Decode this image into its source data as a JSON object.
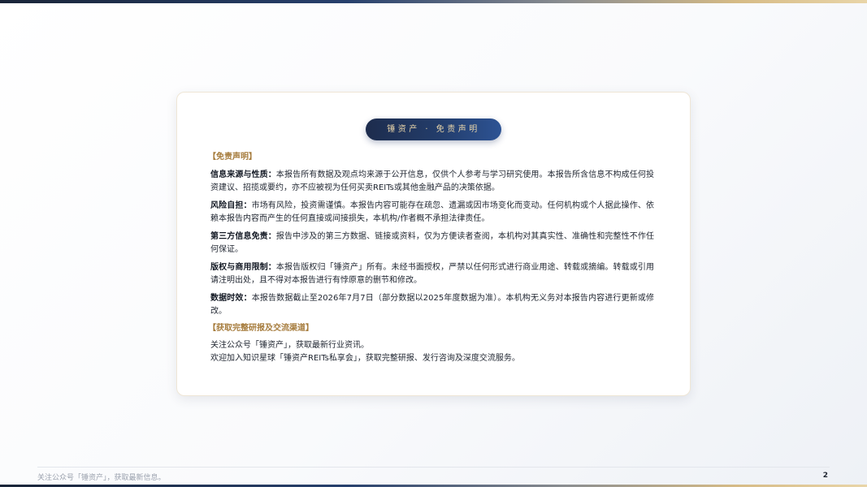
{
  "header": {
    "badge": "锤资产 · 免责声明"
  },
  "disclaimer": {
    "title": "【免责声明】",
    "items": [
      {
        "label": "信息来源与性质：",
        "text": "本报告所有数据及观点均来源于公开信息，仅供个人参考与学习研究使用。本报告所含信息不构成任何投资建议、招揽或要约，亦不应被视为任何买卖REITs或其他金融产品的决策依据。"
      },
      {
        "label": "风险自担：",
        "text": "市场有风险，投资需谨慎。本报告内容可能存在疏忽、遗漏或因市场变化而变动。任何机构或个人据此操作、依赖本报告内容而产生的任何直接或间接损失，本机构/作者概不承担法律责任。"
      },
      {
        "label": "第三方信息免责：",
        "text": "报告中涉及的第三方数据、链接或资料，仅为方便读者查阅，本机构对其真实性、准确性和完整性不作任何保证。"
      },
      {
        "label": "版权与商用限制：",
        "text": "本报告版权归「锤资产」所有。未经书面授权，严禁以任何形式进行商业用途、转载或摘编。转载或引用请注明出处，且不得对本报告进行有悖原意的删节和修改。"
      },
      {
        "label": "数据时效：",
        "text": "本报告数据截止至2026年7月7日（部分数据以2025年度数据为准）。本机构无义务对本报告内容进行更新或修改。"
      }
    ]
  },
  "channels": {
    "title": "【获取完整研报及交流渠道】",
    "lines": [
      "关注公众号「锤资产」，获取最新行业资讯。",
      "欢迎加入知识星球「锤资产REITs私享会」，获取完整研报、发行咨询及深度交流服务。"
    ]
  },
  "footer": {
    "text": "关注公众号「锤资产」，获取最新信息。",
    "page_number": "2"
  },
  "colors": {
    "accent_gold": "#a67c3d",
    "navy": "#233d6b"
  }
}
